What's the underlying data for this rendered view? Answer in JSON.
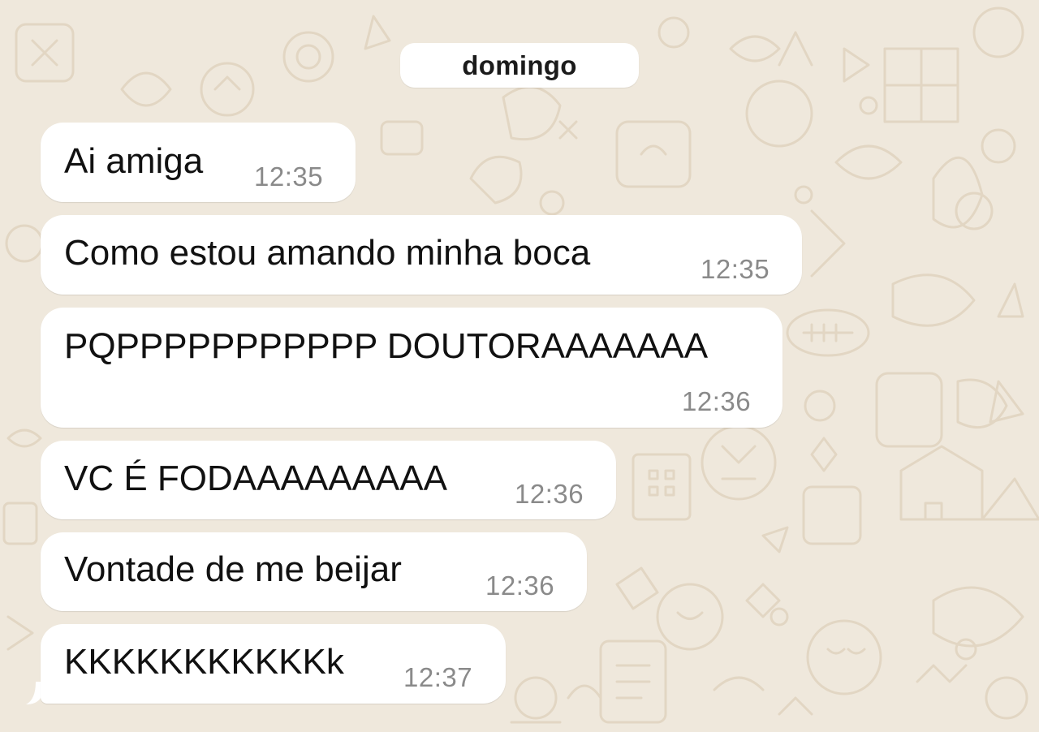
{
  "chat": {
    "date_label": "domingo",
    "messages": [
      {
        "text": "Ai amiga",
        "time": "12:35"
      },
      {
        "text": "Como estou amando minha boca",
        "time": "12:35"
      },
      {
        "text": "PQPPPPPPPPPPP DOUTORAAAAAAA",
        "time": "12:36"
      },
      {
        "text": "VC É FODAAAAAAAAA",
        "time": "12:36"
      },
      {
        "text": "Vontade de me beijar",
        "time": "12:36"
      },
      {
        "text": "KKKKKKKKKKKk",
        "time": "12:37"
      }
    ]
  },
  "colors": {
    "wallpaper": "#efe8dc",
    "doodle": "#e3d8c6",
    "bubble": "#ffffff",
    "timestamp": "#8a8a8a"
  }
}
